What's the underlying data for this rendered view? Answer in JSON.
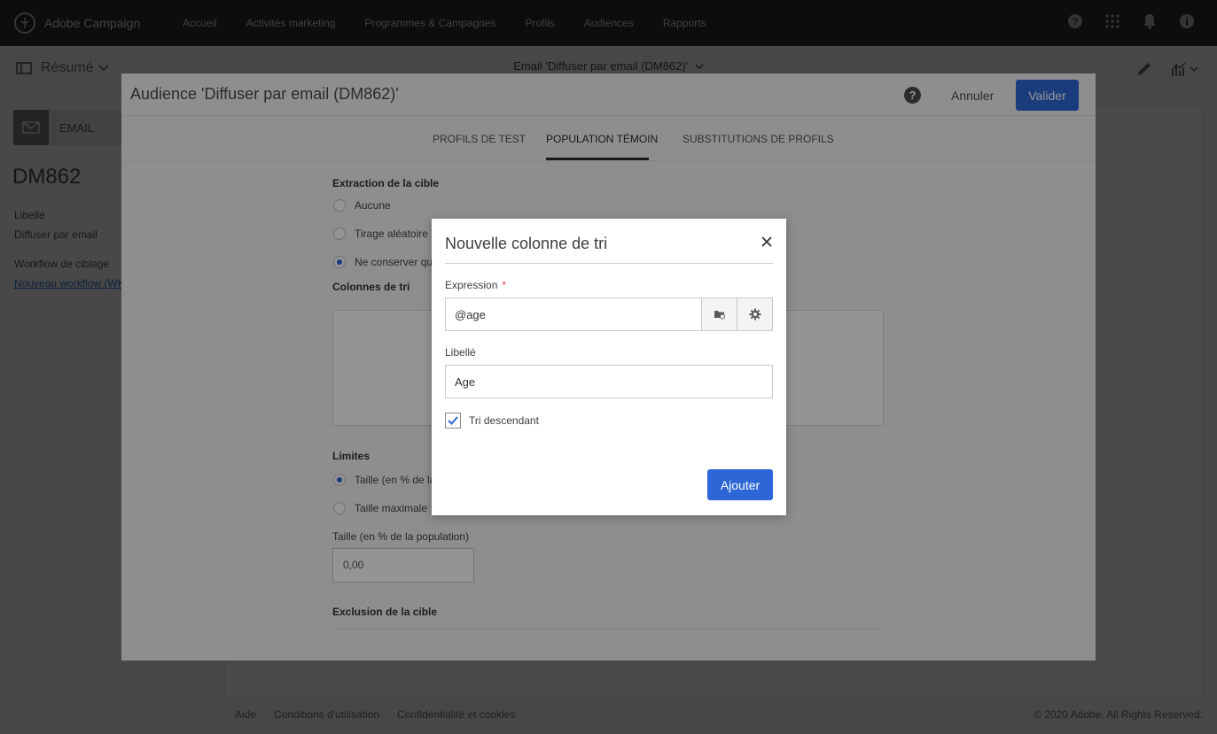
{
  "app": {
    "name": "Adobe Campaign",
    "nav": [
      "Accueil",
      "Activités marketing",
      "Programmes & Campagnes",
      "Profils",
      "Audiences",
      "Rapports"
    ],
    "icons": [
      "help-icon",
      "apps-grid-icon",
      "bell-icon",
      "user-info-icon"
    ]
  },
  "page": {
    "summary_label": "Résumé",
    "breadcrumb": "Email 'Diffuser par email (DM862)'",
    "email_card_label": "EMAIL",
    "delivery_id": "DM862",
    "label_caption": "Libellé",
    "label_value": "Diffuser par email",
    "workflow_caption": "Workflow de ciblage",
    "workflow_link": "Nouveau workflow (WK",
    "footer_links": [
      "Aide",
      "Conditions d'utilisation",
      "Confidentialité et cookies"
    ],
    "copyright": "© 2020 Adobe. All Rights Reserved."
  },
  "audience_dialog": {
    "title": "Audience 'Diffuser par email (DM862)'",
    "cancel": "Annuler",
    "validate": "Valider",
    "tabs": [
      "PROFILS DE TEST",
      "POPULATION TÉMOIN",
      "SUBSTITUTIONS DE PROFILS"
    ],
    "active_tab": "POPULATION TÉMOIN",
    "extraction_title": "Extraction de la cible",
    "extraction_options": [
      "Aucune",
      "Tirage aléatoire",
      "Ne conserver que"
    ],
    "extraction_selected": "Ne conserver que",
    "sort_columns_title": "Colonnes de tri",
    "limits_title": "Limites",
    "limit_options": [
      "Taille (en % de la",
      "Taille maximale"
    ],
    "limit_selected": "Taille (en % de la",
    "size_label": "Taille (en % de la population)",
    "size_value": "0,00",
    "exclusion_title": "Exclusion de la cible"
  },
  "sort_dialog": {
    "title": "Nouvelle colonne de tri",
    "expression_label": "Expression",
    "required_mark": "*",
    "expression_value": "@age",
    "label_label": "Libellé",
    "label_value": "Age",
    "descending_label": "Tri descendant",
    "descending_checked": true,
    "add": "Ajouter"
  },
  "colors": {
    "topbar": "#2f2f2f",
    "accent": "#2d66d6",
    "required": "#e14a4a"
  }
}
